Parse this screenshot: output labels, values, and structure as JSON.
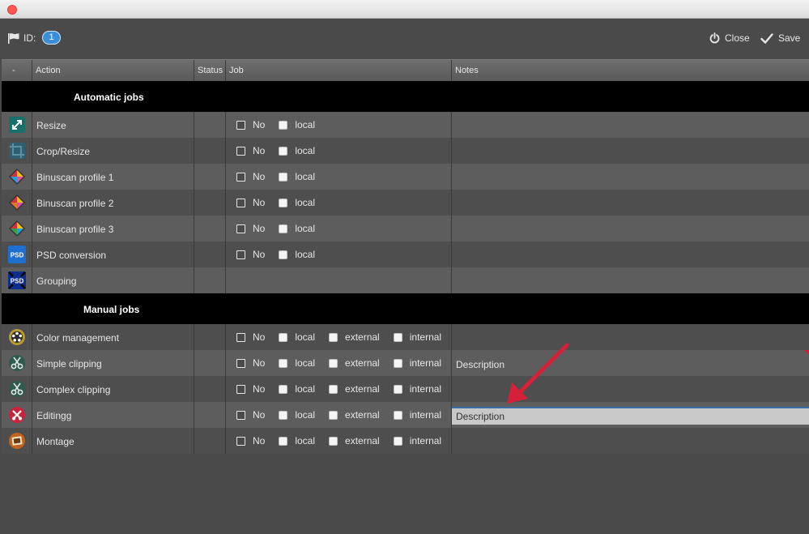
{
  "window": {
    "close_color": "#fc5753"
  },
  "toolbar": {
    "id_label": "ID:",
    "id_value": "1",
    "close_label": "Close",
    "save_label": "Save"
  },
  "table": {
    "headers": [
      "-",
      "Action",
      "Status",
      "Job",
      "Notes"
    ],
    "groups": [
      {
        "label": "Automatic jobs",
        "rows": [
          {
            "action": "Resize",
            "icon": "resize-icon",
            "jobs": [
              "No",
              "local"
            ],
            "notes": ""
          },
          {
            "action": "Crop/Resize",
            "icon": "crop-icon",
            "jobs": [
              "No",
              "local"
            ],
            "notes": ""
          },
          {
            "action": "Binuscan profile 1",
            "icon": "binuscan-icon",
            "jobs": [
              "No",
              "local"
            ],
            "notes": ""
          },
          {
            "action": "Binuscan profile 2",
            "icon": "binuscan-icon",
            "jobs": [
              "No",
              "local"
            ],
            "notes": ""
          },
          {
            "action": "Binuscan profile 3",
            "icon": "binuscan-icon",
            "jobs": [
              "No",
              "local"
            ],
            "notes": ""
          },
          {
            "action": "PSD conversion",
            "icon": "psd-icon",
            "icon_text": "PSD",
            "jobs": [
              "No",
              "local"
            ],
            "notes": ""
          },
          {
            "action": "Grouping",
            "icon": "psd-grouping-icon",
            "icon_text": "PSD",
            "jobs": [],
            "notes": ""
          }
        ]
      },
      {
        "label": "Manual jobs",
        "rows": [
          {
            "action": "Color management",
            "icon": "color-management-icon",
            "jobs": [
              "No",
              "local",
              "external",
              "internal"
            ],
            "notes": ""
          },
          {
            "action": "Simple clipping",
            "icon": "scissors-icon",
            "jobs": [
              "No",
              "local",
              "external",
              "internal"
            ],
            "notes": "Description"
          },
          {
            "action": "Complex clipping",
            "icon": "scissors-icon",
            "jobs": [
              "No",
              "local",
              "external",
              "internal"
            ],
            "notes": ""
          },
          {
            "action": "Editingg",
            "icon": "editing-icon",
            "jobs": [
              "No",
              "local",
              "external",
              "internal"
            ],
            "notes_input": "Description"
          },
          {
            "action": "Montage",
            "icon": "montage-icon",
            "jobs": [
              "No",
              "local",
              "external",
              "internal"
            ],
            "notes": ""
          }
        ]
      }
    ]
  },
  "annotation": {
    "arrow_color": "#d6203a"
  }
}
